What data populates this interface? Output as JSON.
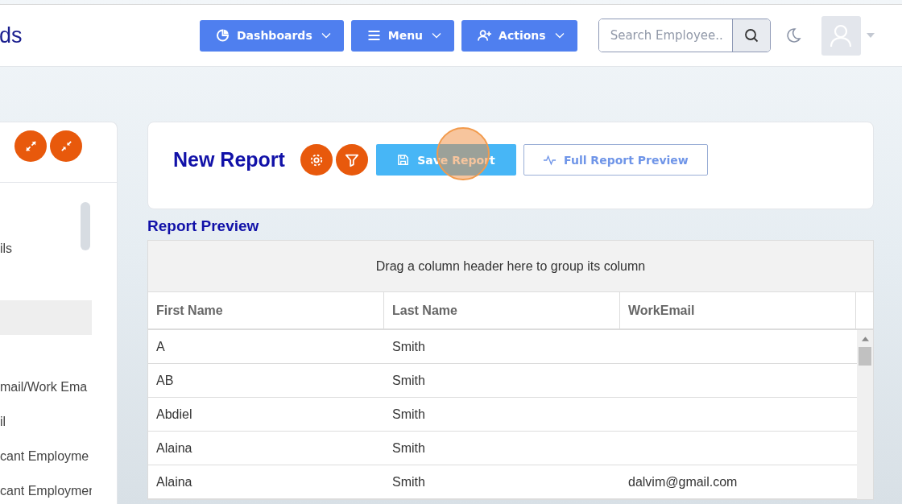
{
  "header": {
    "brand": "ds",
    "nav": [
      {
        "kind": "dashboards",
        "label": "Dashboards"
      },
      {
        "kind": "menu",
        "label": "Menu"
      },
      {
        "kind": "actions",
        "label": "Actions"
      }
    ],
    "search": {
      "placeholder": "Search Employee.."
    }
  },
  "sidebar": {
    "items": [
      {
        "label": "ils",
        "selected": false
      },
      {
        "selected": true
      },
      {
        "label": "mail/Work Ema",
        "selected": false
      },
      {
        "label": "il",
        "selected": false
      },
      {
        "label": "cant Employme",
        "selected": false
      },
      {
        "label": "cant Employmer",
        "selected": false
      }
    ]
  },
  "report": {
    "title": "New Report",
    "save_label": "Save Report",
    "preview_label": "Full Report Preview"
  },
  "preview": {
    "title": "Report Preview",
    "group_hint": "Drag a column header here to group its column",
    "columns": [
      "First Name",
      "Last Name",
      "WorkEmail"
    ],
    "rows": [
      [
        "A",
        "Smith",
        ""
      ],
      [
        "AB",
        "Smith",
        ""
      ],
      [
        "Abdiel",
        "Smith",
        ""
      ],
      [
        "Alaina",
        "Smith",
        ""
      ],
      [
        "Alaina",
        "Smith",
        "dalvim@gmail.com"
      ]
    ]
  }
}
